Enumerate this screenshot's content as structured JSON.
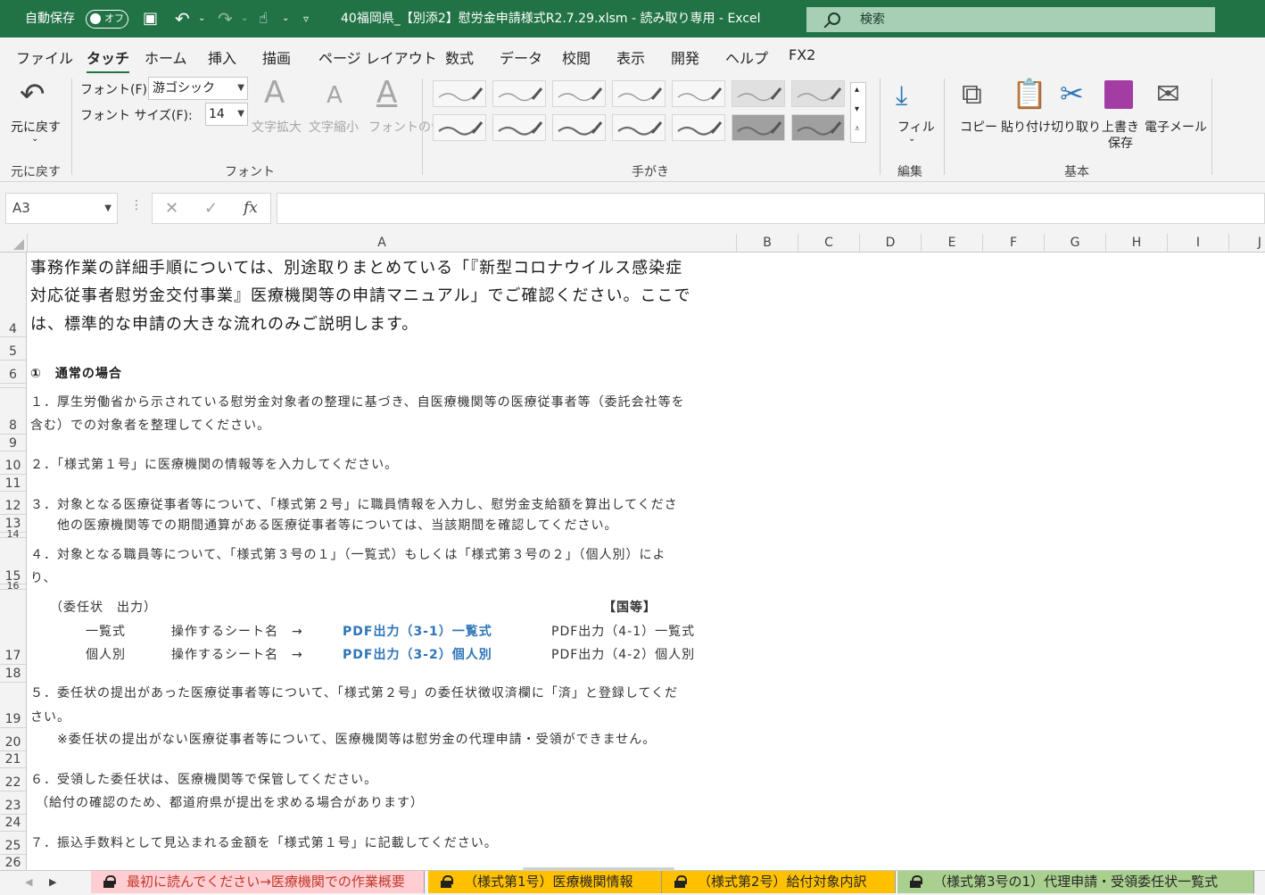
{
  "titlebar": {
    "autosave_label": "自動保存",
    "autosave_state": "オフ",
    "filename": "40福岡県_【別添2】慰労金申請様式R2.7.29.xlsm  -  読み取り専用  -  Excel",
    "search_placeholder": "検索"
  },
  "tabs": [
    "ファイル",
    "タッチ",
    "ホーム",
    "挿入",
    "描画",
    "ページ レイアウト",
    "数式",
    "データ",
    "校閲",
    "表示",
    "開発",
    "ヘルプ",
    "FX2"
  ],
  "ribbon": {
    "undo": {
      "label": "元に戻す",
      "group": "元に戻す"
    },
    "font": {
      "font_label": "フォント(F):",
      "font_value": "游ゴシック",
      "size_label": "フォント サイズ(F):",
      "size_value": "14",
      "grow": "文字拡大",
      "shrink": "文字縮小",
      "color": "フォントの色",
      "group": "フォント"
    },
    "pens": {
      "group": "手がき"
    },
    "edit": {
      "fill": "フィル",
      "group": "編集"
    },
    "basic": {
      "copy": "コピー",
      "paste": "貼り付け",
      "cut": "切り取り",
      "save_line1": "上書き",
      "save_line2": "保存",
      "mail": "電子メール",
      "group": "基本"
    }
  },
  "formula": {
    "namebox": "A3",
    "fx": "fx"
  },
  "columns": [
    "A",
    "B",
    "C",
    "D",
    "E",
    "F",
    "G",
    "H",
    "I",
    "J"
  ],
  "rows": [
    "4",
    "5",
    "6",
    "8",
    "9",
    "10",
    "11",
    "12",
    "13",
    "14",
    "15",
    "16",
    "17",
    "18",
    "19",
    "20",
    "21",
    "22",
    "23",
    "24",
    "25",
    "26"
  ],
  "sheet": {
    "intro": [
      "事務作業の詳細手順については、別途取りまとめている「『新型コロナウイルス感染症",
      "対応従事者慰労金交付事業』医療機関等の申請マニュアル」でご確認ください。ここで",
      "は、標準的な申請の大きな流れのみご説明します。"
    ],
    "heading": "①　通常の場合",
    "step1a": "１．厚生労働省から示されている慰労金対象者の整理に基づき、自医療機関等の医療従事者等（委託会社等を",
    "step1b": "含む）での対象者を整理してください。",
    "step2": "２．「様式第１号」に医療機関の情報等を入力してください。",
    "step3a": "３．対象となる医療従事者等について、「様式第２号」に職員情報を入力し、慰労金支給額を算出してくださ",
    "step3b": "他の医療機関等での期間通算がある医療従事者等については、当該期間を確認してください。",
    "step4a": "４．対象となる職員等について、「様式第３号の１」（一覧式）もしくは「様式第３号の２」（個人別）によ",
    "step4b": "り、",
    "proxy": "（委任状　出力）",
    "kokuto": "【国等】",
    "list_label": "一覧式",
    "indiv_label": "個人別",
    "sheetname1": "操作するシート名　→",
    "sheetname2": "操作するシート名　→",
    "link1": "PDF出力（3-1）一覧式",
    "link2": "PDF出力（3-2）個人別",
    "pdf41": "PDF出力（4-1）一覧式",
    "pdf42": "PDF出力（4-2）個人別",
    "step5a": "５．委任状の提出があった医療従事者等について、「様式第２号」の委任状徴収済欄に「済」と登録してくだ",
    "step5b": "さい。",
    "step5note": "※委任状の提出がない医療従事者等について、医療機関等は慰労金の代理申請・受領ができません。",
    "step6": "６．受領した委任状は、医療機関等で保管してください。",
    "step6note": "（給付の確認のため、都道府県が提出を求める場合があります）",
    "step7": "７．振込手数料として見込まれる金額を「様式第１号」に記載してください。"
  },
  "sheet_tabs": [
    {
      "label": "最初に読んでください→医療機関での作業概要",
      "color": "#ffcdd2",
      "text_color": "#c0392b"
    },
    {
      "label": "（様式第1号）医療機関情報",
      "color": "#ffc000",
      "text_color": "#262626"
    },
    {
      "label": "（様式第2号）給付対象内訳",
      "color": "#ffc000",
      "text_color": "#262626"
    },
    {
      "label": "（様式第3号の1）代理申請・受領委任状一覧式",
      "color": "#a9d08e",
      "text_color": "#262626"
    }
  ],
  "colors": {
    "brand": "#217346",
    "link": "#2e75b6"
  }
}
